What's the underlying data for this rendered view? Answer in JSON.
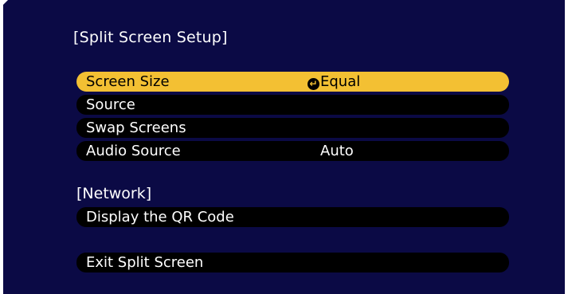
{
  "menu": {
    "title": "[Split Screen Setup]",
    "items": [
      {
        "label": "Screen Size",
        "value": "Equal",
        "selected": true,
        "icon": "enter-icon"
      },
      {
        "label": "Source",
        "value": ""
      },
      {
        "label": "Swap Screens",
        "value": ""
      },
      {
        "label": "Audio Source",
        "value": "Auto"
      }
    ]
  },
  "network": {
    "title": "[Network]",
    "items": [
      {
        "label": "Display the QR Code"
      }
    ]
  },
  "exit": {
    "label": "Exit Split Screen"
  },
  "colors": {
    "background": "#0b0a45",
    "highlight": "#f3c033",
    "row": "#000000",
    "text": "#ffffff"
  }
}
